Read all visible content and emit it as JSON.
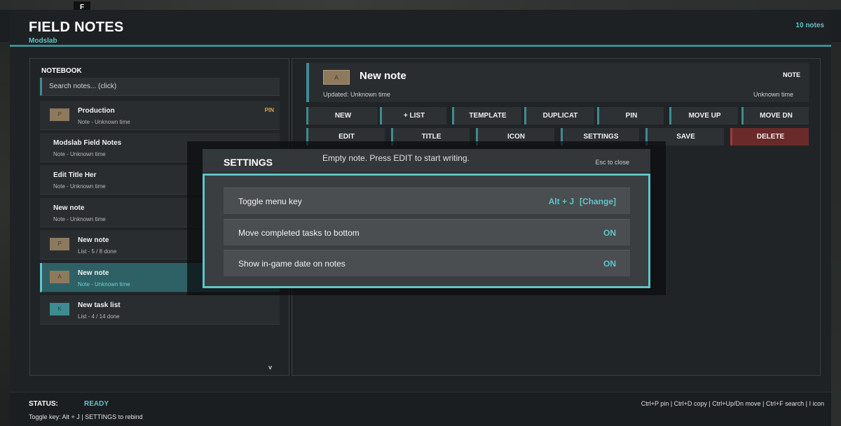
{
  "top": {
    "key_label": "F"
  },
  "header": {
    "title": "FIELD NOTES",
    "subtitle": "Modslab",
    "note_count": "10 notes"
  },
  "notebook": {
    "label": "NOTEBOOK",
    "search_placeholder": "Search notes... (click)",
    "items": [
      {
        "title": "Production",
        "sub": "Note - Unknown time",
        "icon": "P",
        "icon_color": "#8d7a5c",
        "pin": "PIN"
      },
      {
        "title": "Modslab Field Notes",
        "sub": "Note - Unknown time"
      },
      {
        "title": "Edit Title Her",
        "sub": "Note - Unknown time"
      },
      {
        "title": "New note",
        "sub": "Note - Unknown time"
      },
      {
        "title": "New note",
        "sub": "List - 5 / 8 done",
        "icon": "P",
        "icon_color": "#8d7a5c"
      },
      {
        "title": "New note",
        "sub": "Note - Unknown time",
        "icon": "A",
        "icon_color": "#8d7a5c"
      },
      {
        "title": "New task list",
        "sub": "List - 4 / 14 done",
        "icon": "K",
        "icon_color": "#3e8c91"
      }
    ],
    "scroll_indicator": "v"
  },
  "note": {
    "icon": "A",
    "title": "New note",
    "type": "NOTE",
    "updated": "Updated: Unknown time",
    "time": "Unknown time",
    "empty_message": "Empty note. Press EDIT to start writing."
  },
  "toolbar": {
    "row1": [
      "NEW",
      "+ LIST",
      "TEMPLATE",
      "DUPLICAT",
      "PIN",
      "MOVE UP",
      "MOVE DN"
    ],
    "row2": [
      "EDIT",
      "TITLE",
      "ICON",
      "SETTINGS",
      "SAVE",
      "DELETE"
    ]
  },
  "settings": {
    "title": "SETTINGS",
    "close_hint": "Esc to close",
    "rows": [
      {
        "label": "Toggle menu key",
        "value": "Alt + J",
        "action": "[Change]"
      },
      {
        "label": "Move completed tasks to bottom",
        "value": "ON"
      },
      {
        "label": "Show in-game date on notes",
        "value": "ON"
      }
    ]
  },
  "status": {
    "label": "STATUS:",
    "value": "READY",
    "hint": "Toggle key: Alt + J  |  SETTINGS to rebind",
    "shortcuts": "Ctrl+P pin | Ctrl+D copy | Ctrl+Up/Dn move | Ctrl+F search | I icon"
  },
  "colors": {
    "accent": "#5fc5c9",
    "accent_dark": "#3e8c91",
    "pin": "#e0a04a",
    "danger": "#6b2a2a"
  }
}
